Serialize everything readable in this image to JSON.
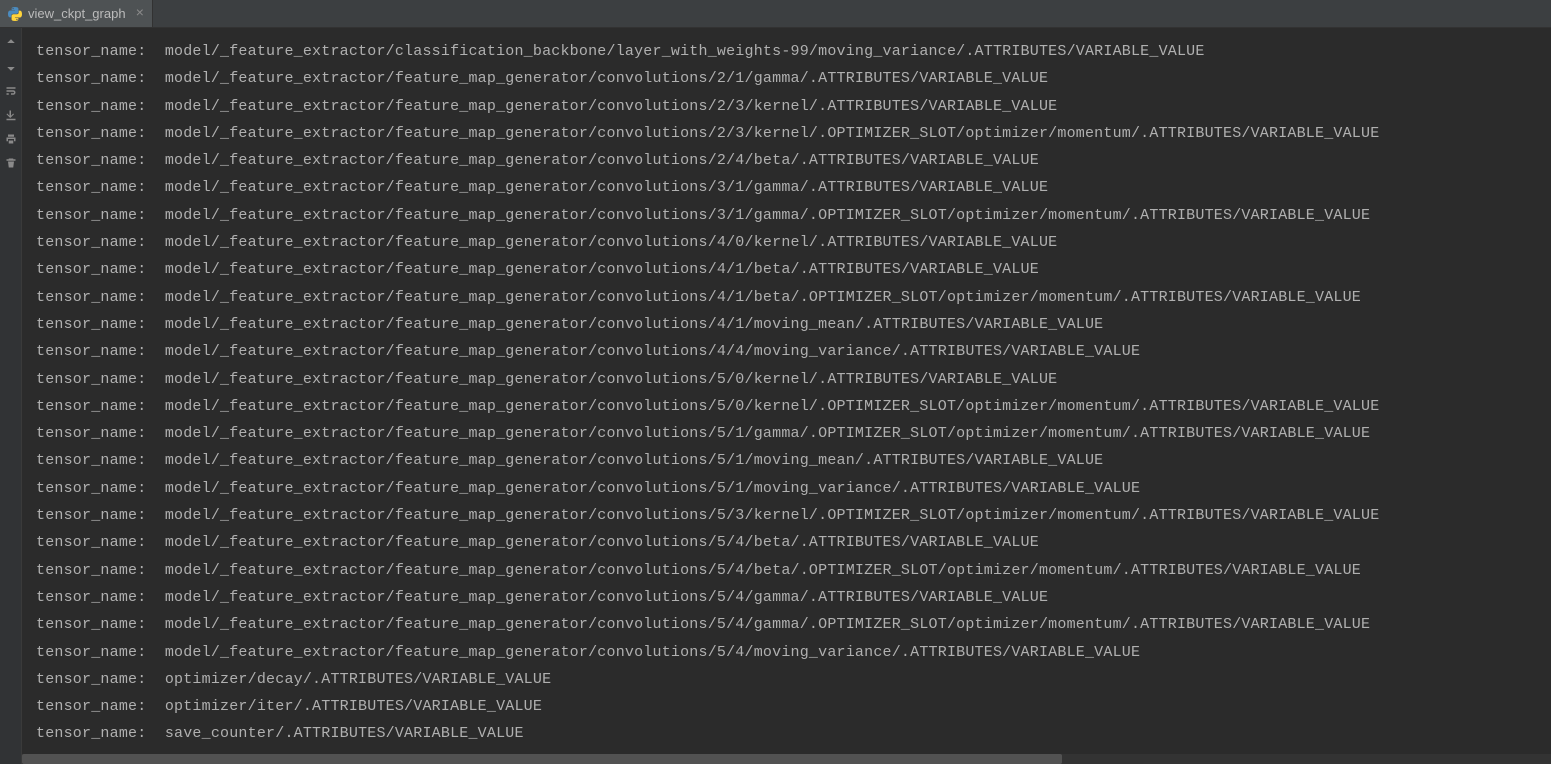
{
  "tab": {
    "label": "view_ckpt_graph",
    "icon": "python-icon",
    "close": "×"
  },
  "label_prefix": "tensor_name:  ",
  "lines": [
    "model/_feature_extractor/classification_backbone/layer_with_weights-99/moving_variance/.ATTRIBUTES/VARIABLE_VALUE",
    "model/_feature_extractor/feature_map_generator/convolutions/2/1/gamma/.ATTRIBUTES/VARIABLE_VALUE",
    "model/_feature_extractor/feature_map_generator/convolutions/2/3/kernel/.ATTRIBUTES/VARIABLE_VALUE",
    "model/_feature_extractor/feature_map_generator/convolutions/2/3/kernel/.OPTIMIZER_SLOT/optimizer/momentum/.ATTRIBUTES/VARIABLE_VALUE",
    "model/_feature_extractor/feature_map_generator/convolutions/2/4/beta/.ATTRIBUTES/VARIABLE_VALUE",
    "model/_feature_extractor/feature_map_generator/convolutions/3/1/gamma/.ATTRIBUTES/VARIABLE_VALUE",
    "model/_feature_extractor/feature_map_generator/convolutions/3/1/gamma/.OPTIMIZER_SLOT/optimizer/momentum/.ATTRIBUTES/VARIABLE_VALUE",
    "model/_feature_extractor/feature_map_generator/convolutions/4/0/kernel/.ATTRIBUTES/VARIABLE_VALUE",
    "model/_feature_extractor/feature_map_generator/convolutions/4/1/beta/.ATTRIBUTES/VARIABLE_VALUE",
    "model/_feature_extractor/feature_map_generator/convolutions/4/1/beta/.OPTIMIZER_SLOT/optimizer/momentum/.ATTRIBUTES/VARIABLE_VALUE",
    "model/_feature_extractor/feature_map_generator/convolutions/4/1/moving_mean/.ATTRIBUTES/VARIABLE_VALUE",
    "model/_feature_extractor/feature_map_generator/convolutions/4/4/moving_variance/.ATTRIBUTES/VARIABLE_VALUE",
    "model/_feature_extractor/feature_map_generator/convolutions/5/0/kernel/.ATTRIBUTES/VARIABLE_VALUE",
    "model/_feature_extractor/feature_map_generator/convolutions/5/0/kernel/.OPTIMIZER_SLOT/optimizer/momentum/.ATTRIBUTES/VARIABLE_VALUE",
    "model/_feature_extractor/feature_map_generator/convolutions/5/1/gamma/.OPTIMIZER_SLOT/optimizer/momentum/.ATTRIBUTES/VARIABLE_VALUE",
    "model/_feature_extractor/feature_map_generator/convolutions/5/1/moving_mean/.ATTRIBUTES/VARIABLE_VALUE",
    "model/_feature_extractor/feature_map_generator/convolutions/5/1/moving_variance/.ATTRIBUTES/VARIABLE_VALUE",
    "model/_feature_extractor/feature_map_generator/convolutions/5/3/kernel/.OPTIMIZER_SLOT/optimizer/momentum/.ATTRIBUTES/VARIABLE_VALUE",
    "model/_feature_extractor/feature_map_generator/convolutions/5/4/beta/.ATTRIBUTES/VARIABLE_VALUE",
    "model/_feature_extractor/feature_map_generator/convolutions/5/4/beta/.OPTIMIZER_SLOT/optimizer/momentum/.ATTRIBUTES/VARIABLE_VALUE",
    "model/_feature_extractor/feature_map_generator/convolutions/5/4/gamma/.ATTRIBUTES/VARIABLE_VALUE",
    "model/_feature_extractor/feature_map_generator/convolutions/5/4/gamma/.OPTIMIZER_SLOT/optimizer/momentum/.ATTRIBUTES/VARIABLE_VALUE",
    "model/_feature_extractor/feature_map_generator/convolutions/5/4/moving_variance/.ATTRIBUTES/VARIABLE_VALUE",
    "optimizer/decay/.ATTRIBUTES/VARIABLE_VALUE",
    "optimizer/iter/.ATTRIBUTES/VARIABLE_VALUE",
    "save_counter/.ATTRIBUTES/VARIABLE_VALUE"
  ]
}
